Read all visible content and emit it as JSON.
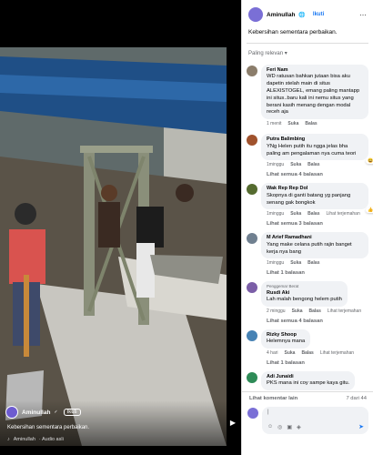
{
  "video": {
    "author": "Aminullah",
    "follow": "Ikuti",
    "caption": "Kebersihan sementara perbaikan.",
    "audio_owner": "Aminullah",
    "audio_label": "· Audio asli",
    "audio_icon": "music-icon"
  },
  "post": {
    "author": "Aminullah",
    "verified_icon": "globe-icon",
    "follow": "Ikuti",
    "caption": "Kebersihan sementara perbaikan."
  },
  "sort_label": "Paling relevan ▾",
  "comments": [
    {
      "name": "Feri Nam",
      "text": "WD ratusan bahkan jutaan bisa aku dapetin stelah main di situs ALEXISTOGEL, emang paling mantapp ini situs..baru kali ini nemu situs yang berani kasih menang dengan modal receh aja",
      "time": "1 menit",
      "like": "Suka",
      "reply": "Balas",
      "color": "#8b7d6b"
    },
    {
      "name": "Putra Balimbing",
      "text": "YNg Helen putih itu ngga jelas bha paling am pengalaman nya cuma teori",
      "time": "1minggu",
      "like": "Suka",
      "reply": "Balas",
      "react_count": "3",
      "see_all": "Lihat semua 4 balasan",
      "color": "#a0522d"
    },
    {
      "name": "Wak Rep Rep Dol",
      "text": "Skopnya di ganti batang yg panjang senang gak bongkok",
      "time": "1minggu",
      "like": "Suka",
      "reply": "Balas",
      "translate": "Lihat terjemahan",
      "react_count": "1",
      "see_all": "Lihat semua 3 balasan",
      "color": "#556b2f"
    },
    {
      "name": "M Arief Ramadhani",
      "text": "Yang make celana putih rajin banget kerja nya bang",
      "time": "1minggu",
      "like": "Suka",
      "reply": "Balas",
      "see_all": "Lihat 1 balasan",
      "color": "#708090"
    },
    {
      "badge": "Penggemar Berat",
      "name": "Rusdi Aki",
      "text": "Lah malah bengong helem putih",
      "time": "2 minggu",
      "like": "Suka",
      "reply": "Balas",
      "translate": "Lihat terjemahan",
      "see_all": "Lihat semua 4 balasan",
      "color": "#7b5ea7"
    },
    {
      "name": "Rizky Shoop",
      "text": "Helemnya mana",
      "time": "4 hari",
      "like": "Suka",
      "reply": "Balas",
      "translate": "Lihat terjemahan",
      "see_all": "Lihat 1 balasan",
      "color": "#4682b4"
    },
    {
      "name": "Adi Junaidi",
      "text": "PKS mana ini coy sampe kaya gitu.",
      "time": "1minggu",
      "like": "Suka",
      "reply": "Balas",
      "color": "#2e8b57"
    }
  ],
  "more_comments": "Lihat komentar lain",
  "count": "7 dari 44",
  "input": {
    "placeholder": "|"
  }
}
